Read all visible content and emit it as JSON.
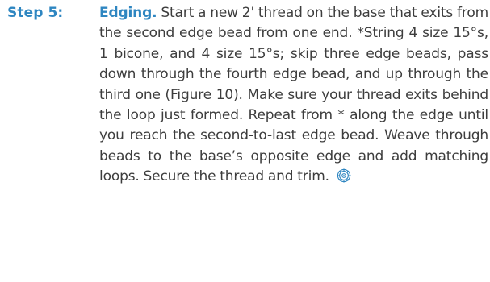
{
  "step": {
    "label": "Step 5:",
    "title": "Edging.",
    "text": " Start a new 2' thread on the base that exits from the second edge bead from one end. *String 4 size 15°s, 1 bicone, and 4 size 15°s; skip three edge beads, pass down through the fourth edge bead, and up through the third one (Figure 10). Make sure your thread exits behind the loop just formed. Repeat from * along the edge until you reach the second-to-last edge bead. Weave through beads to the base’s opposite edge and add matching loops. Secure the thread and trim. "
  },
  "colors": {
    "accent": "#2e86c1",
    "body_text": "#3d3d3d"
  },
  "icons": {
    "end_mark": "beaded-flower-icon"
  }
}
